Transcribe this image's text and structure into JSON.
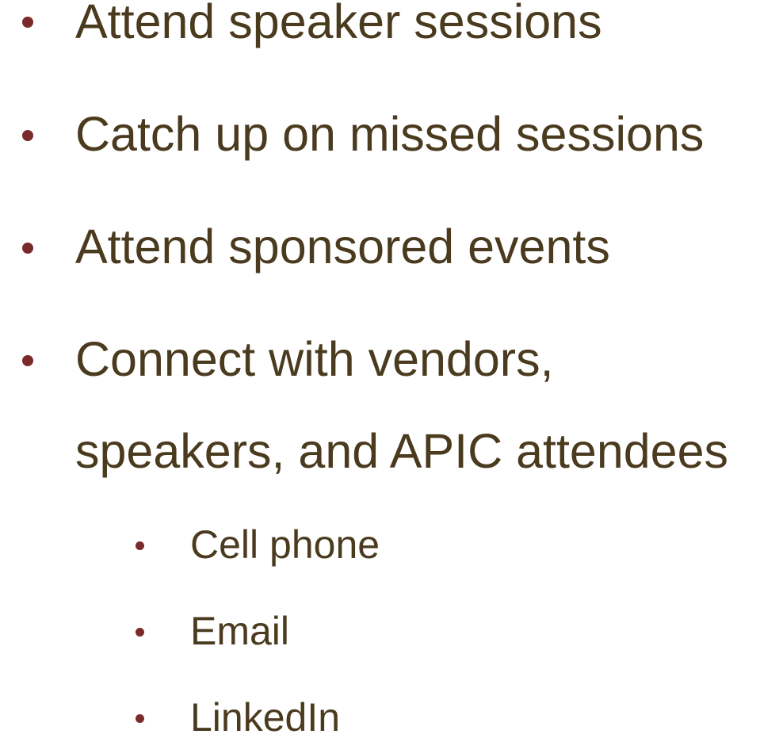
{
  "colors": {
    "text": "#4a3a1e",
    "bullet": "#7b2a2a",
    "background": "#ffffff"
  },
  "bullets": [
    {
      "text": "Attend speaker sessions",
      "level": 1
    },
    {
      "text": "Catch up on missed sessions",
      "level": 1
    },
    {
      "text": "Attend sponsored events",
      "level": 1
    },
    {
      "text": "Connect with vendors,",
      "level": 1
    },
    {
      "text": "speakers, and APIC attendees",
      "level": 1,
      "continuation": true
    },
    {
      "text": "Cell phone",
      "level": 2
    },
    {
      "text": "Email",
      "level": 2
    },
    {
      "text": "LinkedIn",
      "level": 2
    }
  ]
}
